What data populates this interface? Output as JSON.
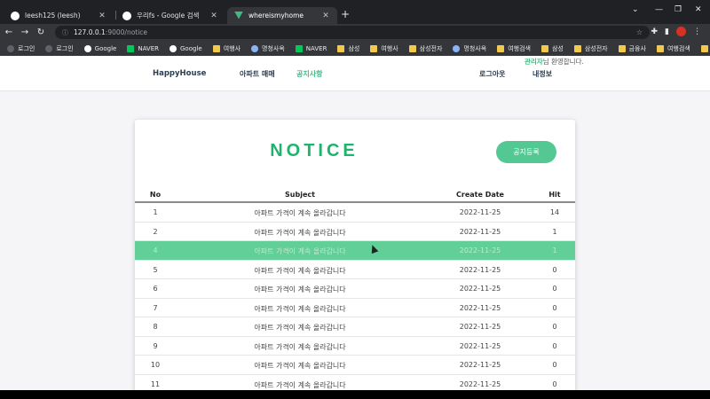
{
  "browser": {
    "tabs": [
      {
        "title": "leesh125 (leesh)",
        "icon": "github-icon"
      },
      {
        "title": "우리fs - Google 검색",
        "icon": "google-icon"
      },
      {
        "title": "whereismyhome",
        "icon": "vue-icon"
      }
    ],
    "url_host": "127.0.0.1",
    "url_path": ":9000/notice",
    "bookmarks": [
      {
        "label": "로그인",
        "icon": "dark"
      },
      {
        "label": "로그인",
        "icon": "dark"
      },
      {
        "label": "Google",
        "icon": "google"
      },
      {
        "label": "NAVER",
        "icon": "naver"
      },
      {
        "label": "Google",
        "icon": "google"
      },
      {
        "label": "여행사",
        "icon": "folder"
      },
      {
        "label": "명청사옥",
        "icon": "globe"
      },
      {
        "label": "NAVER",
        "icon": "naver"
      },
      {
        "label": "삼성",
        "icon": "folder"
      },
      {
        "label": "여행사",
        "icon": "folder"
      },
      {
        "label": "삼성전자",
        "icon": "folder"
      },
      {
        "label": "명청사옥",
        "icon": "globe"
      },
      {
        "label": "여행검색",
        "icon": "folder"
      },
      {
        "label": "삼성",
        "icon": "folder"
      },
      {
        "label": "삼성전자",
        "icon": "folder"
      },
      {
        "label": "금융사",
        "icon": "folder"
      },
      {
        "label": "여행검색",
        "icon": "folder"
      },
      {
        "label": "정공사",
        "icon": "folder"
      }
    ]
  },
  "site": {
    "brand": "HappyHouse",
    "nav": {
      "apt": "아파트 매매",
      "notice": "공지사항"
    },
    "user": {
      "name": "관리자",
      "greeting": "님 환영합니다."
    },
    "logout": "로그아웃",
    "myinfo": "내정보"
  },
  "notice": {
    "title": "NOTICE",
    "register_button": "공지등록",
    "columns": {
      "no": "No",
      "subject": "Subject",
      "date": "Create Date",
      "hit": "Hit"
    },
    "rows": [
      {
        "no": "1",
        "subject": "아파트 가격이 계속 올라갑니다",
        "date": "2022-11-25",
        "hit": "14"
      },
      {
        "no": "2",
        "subject": "아파트 가격이 계속 올라갑니다",
        "date": "2022-11-25",
        "hit": "1"
      },
      {
        "no": "4",
        "subject": "아파트 가격이 계속 올라갑니다",
        "date": "2022-11-25",
        "hit": "1"
      },
      {
        "no": "5",
        "subject": "아파트 가격이 계속 올라갑니다",
        "date": "2022-11-25",
        "hit": "0"
      },
      {
        "no": "6",
        "subject": "아파트 가격이 계속 올라갑니다",
        "date": "2022-11-25",
        "hit": "0"
      },
      {
        "no": "7",
        "subject": "아파트 가격이 계속 올라갑니다",
        "date": "2022-11-25",
        "hit": "0"
      },
      {
        "no": "8",
        "subject": "아파트 가격이 계속 올라갑니다",
        "date": "2022-11-25",
        "hit": "0"
      },
      {
        "no": "9",
        "subject": "아파트 가격이 계속 올라갑니다",
        "date": "2022-11-25",
        "hit": "0"
      },
      {
        "no": "10",
        "subject": "아파트 가격이 계속 올라갑니다",
        "date": "2022-11-25",
        "hit": "0"
      },
      {
        "no": "11",
        "subject": "아파트 가격이 계속 올라갑니다",
        "date": "2022-11-25",
        "hit": "0"
      }
    ]
  },
  "colors": {
    "accent": "#42b983",
    "title": "#1fb36e",
    "highlight_row": "#62cf98"
  }
}
